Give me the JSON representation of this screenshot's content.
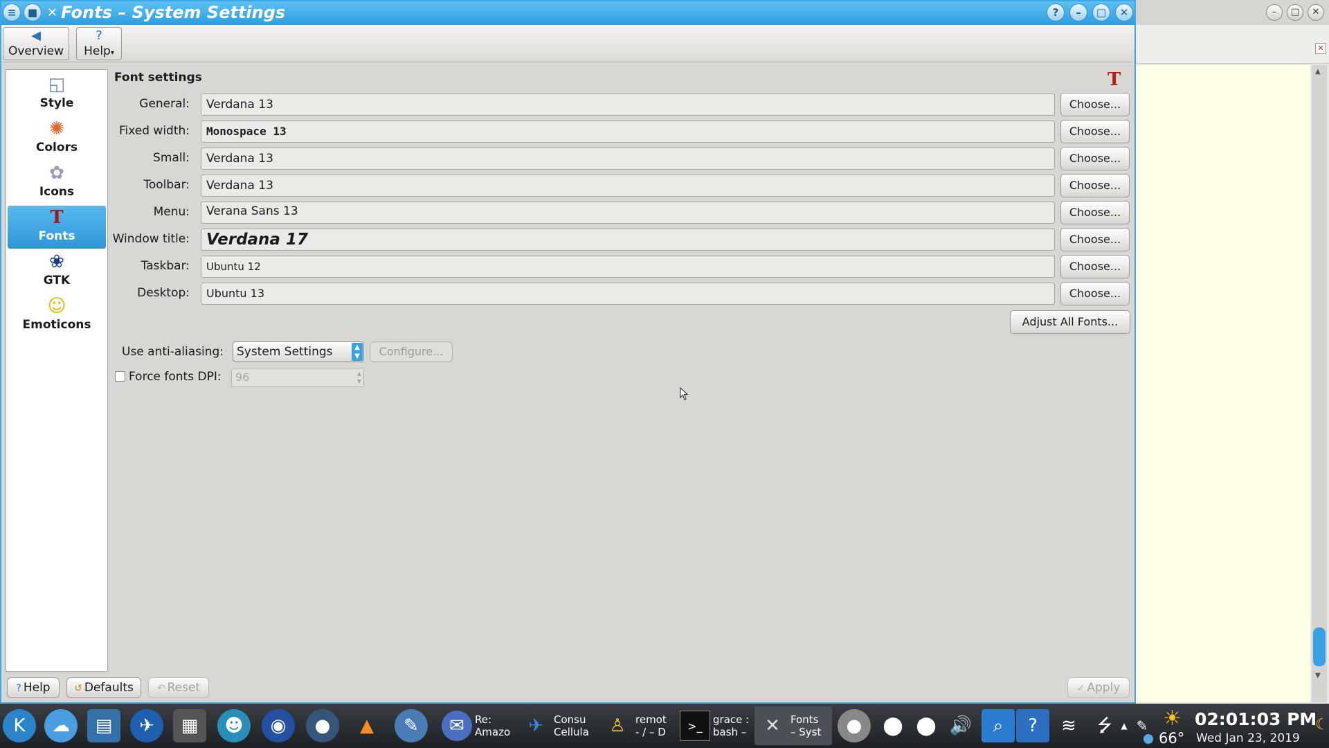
{
  "window": {
    "title": "Fonts – System Settings"
  },
  "toolbar": {
    "overview_label": "Overview",
    "help_label": "Help"
  },
  "sidebar": {
    "items": [
      {
        "label": "Style",
        "icon": "style-icon"
      },
      {
        "label": "Colors",
        "icon": "colors-icon"
      },
      {
        "label": "Icons",
        "icon": "icons-icon"
      },
      {
        "label": "Fonts",
        "icon": "fonts-icon"
      },
      {
        "label": "GTK",
        "icon": "gtk-icon"
      },
      {
        "label": "Emoticons",
        "icon": "emoticons-icon"
      }
    ],
    "active": "Fonts"
  },
  "font_settings": {
    "title": "Font settings",
    "choose_label": "Choose...",
    "rows": [
      {
        "label": "General:",
        "value": "Verdana 13"
      },
      {
        "label": "Fixed width:",
        "value": "Monospace 13"
      },
      {
        "label": "Small:",
        "value": "Verdana 13"
      },
      {
        "label": "Toolbar:",
        "value": "Verdana 13"
      },
      {
        "label": "Menu:",
        "value": "Verana Sans 13"
      },
      {
        "label": "Window title:",
        "value": "Verdana 17"
      },
      {
        "label": "Taskbar:",
        "value": "Ubuntu 12"
      },
      {
        "label": "Desktop:",
        "value": "Ubuntu 13"
      }
    ],
    "adjust_all_label": "Adjust All Fonts...",
    "anti_aliasing_label": "Use anti-aliasing:",
    "anti_aliasing_value": "System Settings",
    "configure_label": "Configure...",
    "force_dpi_label": "Force fonts DPI:",
    "force_dpi_checked": false,
    "dpi_value": "96"
  },
  "bottom_buttons": {
    "help": "Help",
    "defaults": "Defaults",
    "reset": "Reset",
    "apply": "Apply"
  },
  "taskbar": {
    "tasks": [
      {
        "line1": "Re:",
        "line2": "Amazo"
      },
      {
        "line1": "Consu",
        "line2": "Cellula"
      },
      {
        "line1": "remot",
        "line2": "- / – D"
      },
      {
        "line1": "grace :",
        "line2": "bash –"
      },
      {
        "line1": "Fonts",
        "line2": "– Syst"
      }
    ],
    "clock_time": "02:01:03 PM",
    "clock_date": "Wed Jan 23, 2019",
    "temperature": "66°"
  },
  "colors": {
    "accent": "#3ea8e6",
    "sidebar_active": "#3aa0e4",
    "taskbar": "#2a2d32",
    "right_pane": "#fffde2"
  }
}
